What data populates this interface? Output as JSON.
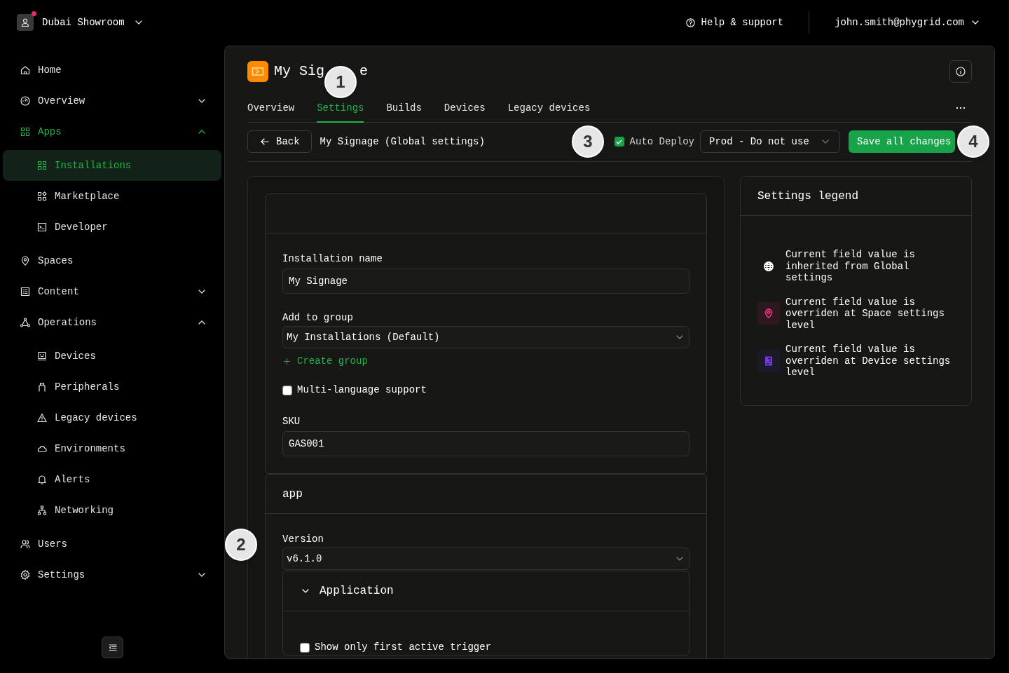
{
  "topbar": {
    "org": {
      "name": "Dubai Showroom",
      "has_notification": true
    },
    "help": "Help & support",
    "user": "john.smith@phygrid.com"
  },
  "sidebar": {
    "items": [
      {
        "label": "Home",
        "selected": false
      },
      {
        "label": "Overview",
        "selected": false,
        "expanded": false
      },
      {
        "label": "Apps",
        "selected": false,
        "expanded": true,
        "children": [
          {
            "label": "Installations",
            "selected": true
          },
          {
            "label": "Marketplace",
            "selected": false
          },
          {
            "label": "Developer",
            "selected": false
          }
        ]
      },
      {
        "label": "Spaces",
        "selected": false
      },
      {
        "label": "Content",
        "selected": false,
        "expanded": false
      },
      {
        "label": "Operations",
        "selected": false,
        "expanded": true,
        "children": [
          {
            "label": "Devices",
            "selected": false
          },
          {
            "label": "Peripherals",
            "selected": false
          },
          {
            "label": "Legacy devices",
            "selected": false
          },
          {
            "label": "Environments",
            "selected": false
          },
          {
            "label": "Alerts",
            "selected": false
          },
          {
            "label": "Networking",
            "selected": false
          }
        ]
      },
      {
        "label": "Users",
        "selected": false
      },
      {
        "label": "Settings",
        "selected": false,
        "expanded": false
      }
    ]
  },
  "app": {
    "title_parts": [
      "My Sig",
      "e"
    ],
    "tabs": [
      {
        "label": "Overview",
        "selected": false
      },
      {
        "label": "Settings",
        "selected": true
      },
      {
        "label": "Builds",
        "selected": false
      },
      {
        "label": "Devices",
        "selected": false
      },
      {
        "label": "Legacy devices",
        "selected": false
      }
    ]
  },
  "toolbar": {
    "back": "Back",
    "breadcrumb": "My Signage (Global settings)",
    "auto_deploy": {
      "label": "Auto Deploy",
      "checked": true
    },
    "environment": "Prod - Do not use",
    "save": "Save all changes"
  },
  "sections": [
    {
      "fields": [
        {
          "kind": "text",
          "label": "Installation name",
          "value": "My Signage"
        },
        {
          "kind": "select",
          "label": "Add to group",
          "value": "My Installations (Default)"
        },
        {
          "kind": "link",
          "label": "Create group"
        },
        {
          "kind": "checkbox",
          "label": "Multi-language support",
          "checked": false
        },
        {
          "kind": "text",
          "label": "SKU",
          "value": "GAS001"
        }
      ]
    },
    {
      "title": "app",
      "fields": [
        {
          "kind": "select",
          "label": "Version",
          "value": "v6.1.0"
        },
        {
          "kind": "group",
          "title": "Application",
          "expanded": true,
          "fields": [
            {
              "kind": "checkbox",
              "label": "Show only first active trigger",
              "checked": false
            }
          ]
        }
      ]
    }
  ],
  "legend": {
    "title": "Settings legend",
    "items": [
      {
        "text": "Current field value is inherited from Global settings",
        "color": "#ffffff"
      },
      {
        "text": "Current field value is overriden at Space settings level",
        "color": "#e0357a"
      },
      {
        "text": "Current field value is overriden at Device settings level",
        "color": "#7c3aed"
      }
    ]
  },
  "callouts": [
    "1",
    "2",
    "3",
    "4"
  ]
}
